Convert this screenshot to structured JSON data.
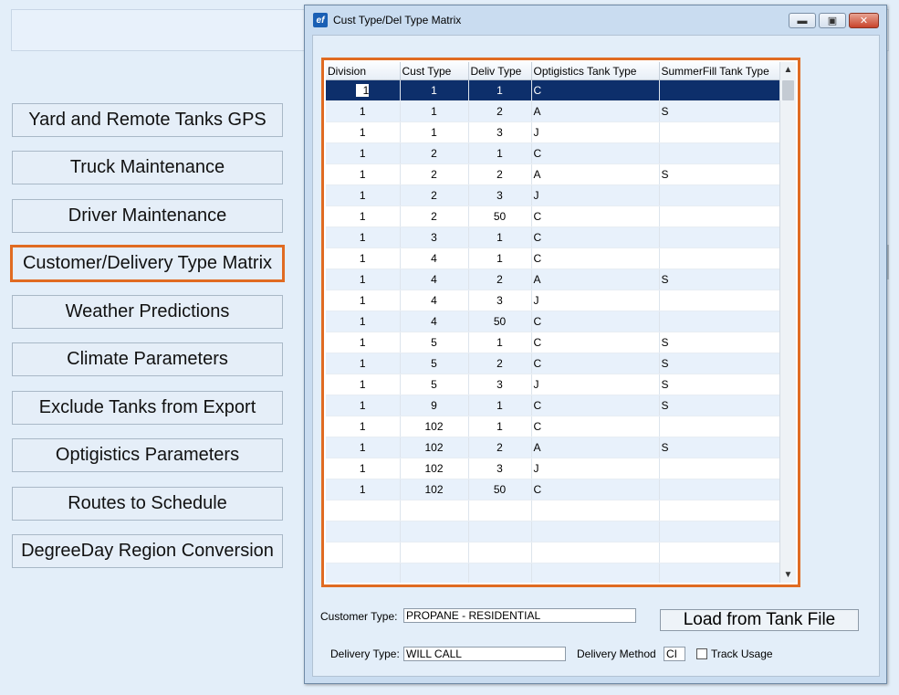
{
  "window": {
    "title": "Cust Type/Del Type Matrix",
    "app_icon": "ef",
    "minimize_icon": "minimize-icon",
    "maximize_icon": "maximize-icon",
    "close_icon": "close-icon"
  },
  "sidebar": {
    "items": [
      {
        "label": "Yard and Remote Tanks GPS"
      },
      {
        "label": "Truck Maintenance"
      },
      {
        "label": "Driver Maintenance"
      },
      {
        "label": "Customer/Delivery Type Matrix",
        "selected": true
      },
      {
        "label": "Weather Predictions"
      },
      {
        "label": "Climate Parameters"
      },
      {
        "label": "Exclude Tanks from Export"
      },
      {
        "label": "Optigistics Parameters"
      },
      {
        "label": "Routes to Schedule"
      },
      {
        "label": "DegreeDay Region Conversion"
      }
    ]
  },
  "grid": {
    "columns": [
      "Division",
      "Cust Type",
      "Deliv Type",
      "Optigistics Tank Type",
      "SummerFill Tank Type"
    ],
    "rows": [
      [
        "1",
        "1",
        "1",
        "C",
        ""
      ],
      [
        "1",
        "1",
        "2",
        "A",
        "S"
      ],
      [
        "1",
        "1",
        "3",
        "J",
        ""
      ],
      [
        "1",
        "2",
        "1",
        "C",
        ""
      ],
      [
        "1",
        "2",
        "2",
        "A",
        "S"
      ],
      [
        "1",
        "2",
        "3",
        "J",
        ""
      ],
      [
        "1",
        "2",
        "50",
        "C",
        ""
      ],
      [
        "1",
        "3",
        "1",
        "C",
        ""
      ],
      [
        "1",
        "4",
        "1",
        "C",
        ""
      ],
      [
        "1",
        "4",
        "2",
        "A",
        "S"
      ],
      [
        "1",
        "4",
        "3",
        "J",
        ""
      ],
      [
        "1",
        "4",
        "50",
        "C",
        ""
      ],
      [
        "1",
        "5",
        "1",
        "C",
        "S"
      ],
      [
        "1",
        "5",
        "2",
        "C",
        "S"
      ],
      [
        "1",
        "5",
        "3",
        "J",
        "S"
      ],
      [
        "1",
        "9",
        "1",
        "C",
        "S"
      ],
      [
        "1",
        "102",
        "1",
        "C",
        ""
      ],
      [
        "1",
        "102",
        "2",
        "A",
        "S"
      ],
      [
        "1",
        "102",
        "3",
        "J",
        ""
      ],
      [
        "1",
        "102",
        "50",
        "C",
        ""
      ]
    ],
    "empty_rows": 4,
    "selected_row": 0,
    "scroll_up_icon": "chevron-up-icon",
    "scroll_down_icon": "chevron-down-icon"
  },
  "form": {
    "customer_type_label": "Customer Type:",
    "customer_type_value": "PROPANE - RESIDENTIAL",
    "load_button": "Load from Tank File",
    "delivery_type_label": "Delivery Type:",
    "delivery_type_value": "WILL CALL",
    "delivery_method_label": "Delivery Method",
    "delivery_method_value": "CI",
    "track_usage_label": "Track Usage",
    "track_usage_checked": false
  },
  "colors": {
    "highlight": "#e06b22",
    "selection": "#0d2f6b",
    "background": "#e3eef9"
  }
}
